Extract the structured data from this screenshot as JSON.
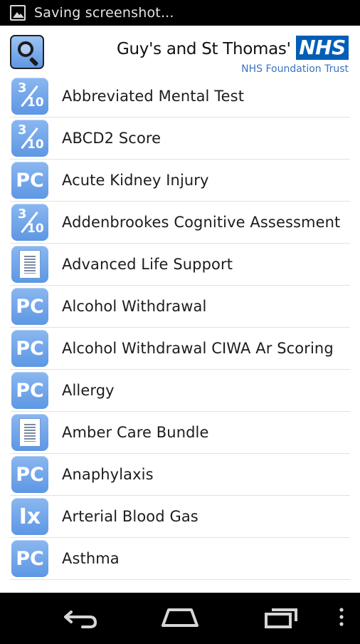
{
  "status_bar": {
    "notification_text": "Saving screenshot..."
  },
  "header": {
    "search_icon": "search-icon",
    "logo": {
      "trust_name": "Guy's and St Thomas'",
      "nhs_badge": "NHS",
      "subtitle": "NHS Foundation Trust",
      "badge_color": "#005eb8"
    }
  },
  "list": {
    "items": [
      {
        "label": "Abbreviated Mental Test",
        "icon": "score-icon"
      },
      {
        "label": "ABCD2 Score",
        "icon": "score-icon"
      },
      {
        "label": "Acute Kidney Injury",
        "icon": "pc-icon"
      },
      {
        "label": "Addenbrookes Cognitive Assessment",
        "icon": "score-icon"
      },
      {
        "label": "Advanced Life Support",
        "icon": "document-icon"
      },
      {
        "label": "Alcohol Withdrawal",
        "icon": "pc-icon"
      },
      {
        "label": "Alcohol Withdrawal CIWA Ar Scoring",
        "icon": "pc-icon"
      },
      {
        "label": "Allergy",
        "icon": "pc-icon"
      },
      {
        "label": "Amber Care Bundle",
        "icon": "document-icon"
      },
      {
        "label": "Anaphylaxis",
        "icon": "pc-icon"
      },
      {
        "label": "Arterial Blood Gas",
        "icon": "ix-icon"
      },
      {
        "label": "Asthma",
        "icon": "pc-icon"
      }
    ],
    "icon_color": "#6ba3ea"
  },
  "nav_bar": {
    "back": "back-icon",
    "home": "home-icon",
    "recents": "recents-icon",
    "menu": "overflow-menu-icon"
  }
}
